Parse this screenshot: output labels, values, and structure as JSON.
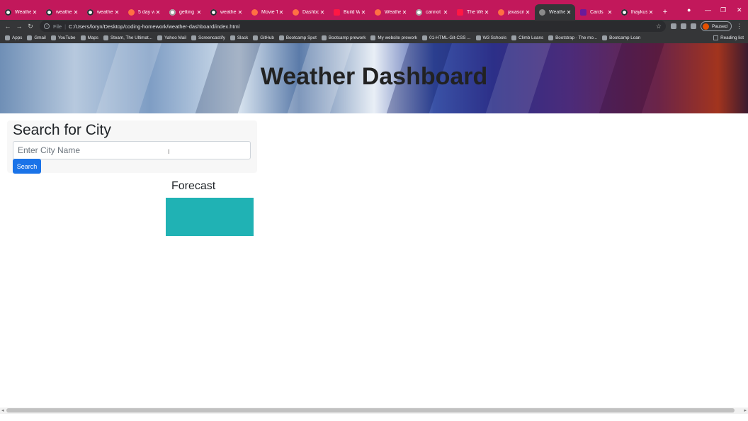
{
  "browser": {
    "tabs": [
      {
        "label": "Weather",
        "icon": "github-icon",
        "active": false
      },
      {
        "label": "weather",
        "icon": "github-icon",
        "active": false
      },
      {
        "label": "weather",
        "icon": "github-icon",
        "active": false
      },
      {
        "label": "5 day w",
        "icon": "page-icon",
        "active": false
      },
      {
        "label": "getting",
        "icon": "google-icon",
        "active": false
      },
      {
        "label": "weather",
        "icon": "github-icon",
        "active": false
      },
      {
        "label": "Movie T",
        "icon": "page-icon",
        "active": false
      },
      {
        "label": "Dashbo",
        "icon": "page-icon",
        "active": false
      },
      {
        "label": "Build W",
        "icon": "youtube-icon",
        "active": false
      },
      {
        "label": "Weathe",
        "icon": "page-icon",
        "active": false
      },
      {
        "label": "cannot",
        "icon": "google-icon",
        "active": false
      },
      {
        "label": "The We",
        "icon": "youtube-icon",
        "active": false
      },
      {
        "label": "javascri",
        "icon": "page-icon",
        "active": false
      },
      {
        "label": "Weather",
        "icon": "globe-icon",
        "active": true
      },
      {
        "label": "Cards",
        "icon": "bootstrap-icon",
        "active": false
      },
      {
        "label": "lhaykus",
        "icon": "github-icon",
        "active": false
      }
    ],
    "new_tab_symbol": "+",
    "url_scheme": "File",
    "url_path": "C:/Users/loryn/Desktop/coding-homework/weather-dashboard/index.html",
    "profile_status": "Paused",
    "reading_list_label": "Reading list",
    "bookmarks": [
      "Apps",
      "Gmail",
      "YouTube",
      "Maps",
      "Steam, The Ultimat...",
      "Yahoo Mail",
      "Screencastify",
      "Slack",
      "GitHub",
      "Bootcamp Spot",
      "Bootcamp prework",
      "My website prework",
      "01-HTML-Git-CSS ...",
      "W3 Schools",
      "Climb Loans",
      "Bootstrap · The mo...",
      "Bootcamp Loan"
    ]
  },
  "page": {
    "title": "Weather Dashboard",
    "search_title": "Search for City",
    "search_placeholder": "Enter City Name",
    "search_value": "",
    "search_button": "Search",
    "forecast_title": "Forecast"
  },
  "colors": {
    "tab_strip": "#c2185b",
    "toolbar": "#353638",
    "search_button": "#1a73e8",
    "forecast_card": "#20b2b4"
  }
}
